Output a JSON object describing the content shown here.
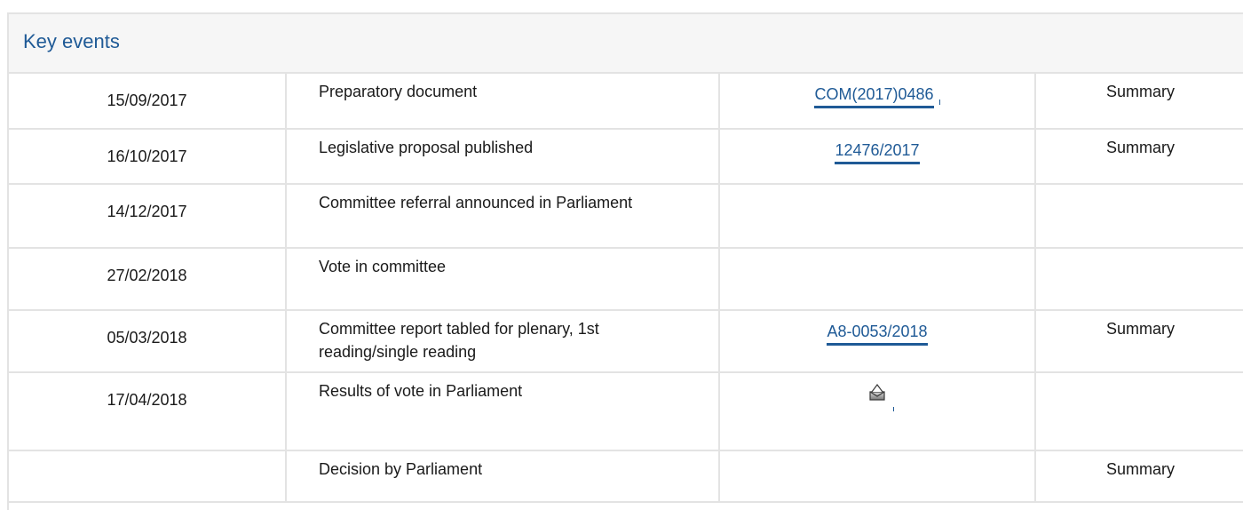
{
  "section": {
    "title": "Key events"
  },
  "events": [
    {
      "date": "15/09/2017",
      "event": "Preparatory document",
      "reference": "COM(2017)0486",
      "summary": "Summary"
    },
    {
      "date": "16/10/2017",
      "event": "Legislative proposal published",
      "reference": "12476/2017",
      "summary": "Summary"
    },
    {
      "date": "14/12/2017",
      "event": "Committee referral announced in Parliament",
      "reference": "",
      "summary": ""
    },
    {
      "date": "27/02/2018",
      "event": "Vote in committee",
      "reference": "",
      "summary": ""
    },
    {
      "date": "05/03/2018",
      "event": "Committee report tabled for plenary, 1st reading/single reading",
      "reference": "A8-0053/2018",
      "summary": "Summary"
    },
    {
      "date": "17/04/2018",
      "event": "Results of vote in Parliament",
      "reference_icon": "vote-results-icon",
      "summary": ""
    },
    {
      "date": "",
      "event": "Decision by Parliament",
      "reference": "",
      "summary": "Summary"
    }
  ],
  "colors": {
    "accent": "#1f5a96",
    "border": "#e3e3e3",
    "header_bg": "#f6f6f6"
  }
}
